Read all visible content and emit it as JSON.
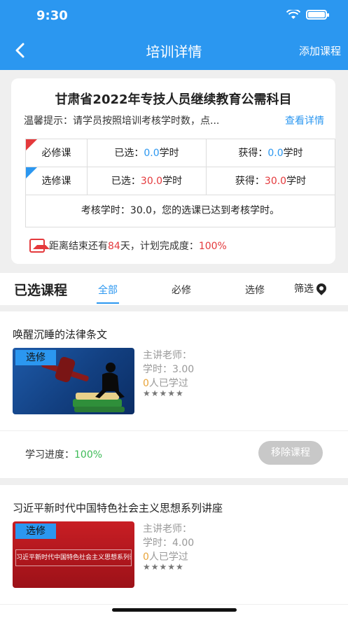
{
  "status_bar": {
    "time": "9:30"
  },
  "header": {
    "title": "培训详情",
    "add_course": "添加课程"
  },
  "summary": {
    "title": "甘肃省2022年专技人员继续教育公需科目",
    "hint": "温馨提示：请学员按照培训考核学时数，点...",
    "hint_link": "查看详情",
    "required": {
      "label": "必修课",
      "selected_label": "已选：",
      "selected_value": "0.0",
      "unit": "学时",
      "earned_label": "获得：",
      "earned_value": "0.0"
    },
    "elective": {
      "label": "选修课",
      "selected_label": "已选：",
      "selected_value": "30.0",
      "unit": "学时",
      "earned_label": "获得：",
      "earned_value": "30.0"
    },
    "exam_note": "考核学时：30.0，您的选课已达到考核学时。",
    "countdown_prefix": "距离结束还有",
    "days": "84",
    "countdown_mid": "天，计划完成度：",
    "completion": "100%"
  },
  "tabs": {
    "title": "已选课程",
    "items": [
      {
        "label": "全部",
        "active": true
      },
      {
        "label": "必修",
        "active": false
      },
      {
        "label": "选修",
        "active": false
      }
    ],
    "filter": "筛选"
  },
  "courses": [
    {
      "title": "唤醒沉睡的法律条文",
      "tag": "选修",
      "teacher": "主讲老师：",
      "hours": "学时：3.00",
      "learners_count": "0",
      "learners_suffix": "人已学过",
      "stars": "★★★★★",
      "progress_label": "学习进度：",
      "progress_value": "100%",
      "remove": "移除课程"
    },
    {
      "title": "习近平新时代中国特色社会主义思想系列讲座",
      "tag": "选修",
      "thumb_text": "习近平新时代中国特色社会主义思想系列讲座",
      "teacher": "主讲老师：",
      "hours": "学时：4.00",
      "learners_count": "0",
      "learners_suffix": "人已学过",
      "stars": "★★★★★"
    }
  ],
  "colors": {
    "primary": "#2b97f0",
    "red": "#e4393c",
    "green": "#3dbb57",
    "orange": "#e8a43a"
  }
}
